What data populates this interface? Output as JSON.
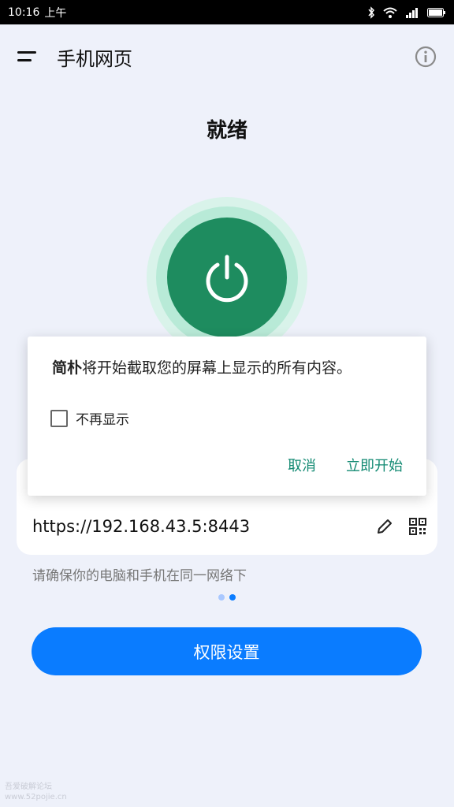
{
  "status_bar": {
    "time": "10:16",
    "ampm": "上午",
    "icons": [
      "bluetooth-icon",
      "wifi-icon",
      "signal-icon",
      "battery-icon"
    ]
  },
  "header": {
    "title": "手机网页",
    "menu_icon": "menu-icon",
    "info_icon": "info-icon"
  },
  "main": {
    "status_title": "就绪",
    "power_icon": "power-icon",
    "card": {
      "label": "",
      "url": "https://192.168.43.5:8443",
      "edit_icon": "pencil-icon",
      "qr_icon": "qr-code-icon"
    },
    "hint": "请确保你的电脑和手机在同一网络下",
    "pager": {
      "count": 2,
      "active_index": 1
    },
    "primary_button": "权限设置"
  },
  "dialog": {
    "app_name": "简朴",
    "message": "将开始截取您的屏幕上显示的所有内容。",
    "checkbox_label": "不再显示",
    "checkbox_checked": false,
    "cancel_label": "取消",
    "confirm_label": "立即开始"
  },
  "watermark": {
    "line1": "吾爱破解论坛",
    "line2": "www.52pojie.cn"
  },
  "colors": {
    "accent_blue": "#0a7cff",
    "power_green": "#1e8c5f",
    "dialog_button_teal": "#138a73",
    "background": "#eef1fa"
  }
}
